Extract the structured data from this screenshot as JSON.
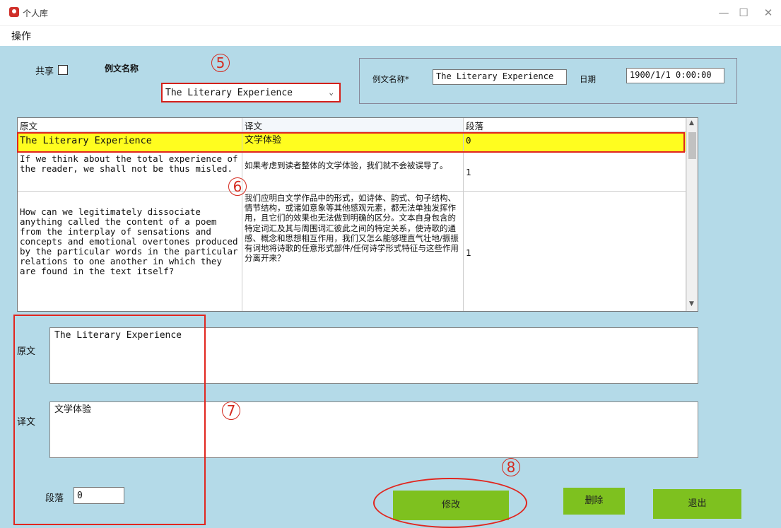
{
  "window": {
    "title": "个人库",
    "minimize_icon": "minimize-icon",
    "maximize_icon": "maximize-icon",
    "close_icon": "close-icon"
  },
  "menu": {
    "operate": "操作"
  },
  "share": {
    "label": "共享",
    "checked": false
  },
  "example_name_label": "例文名称",
  "example_combo": {
    "value": "The Literary Experience"
  },
  "info": {
    "name_label": "例文名称*",
    "name_value": "The Literary Experience",
    "date_label": "日期",
    "date_value": "1900/1/1 0:00:00"
  },
  "grid": {
    "headers": [
      "原文",
      "译文",
      "段落"
    ],
    "rows": [
      {
        "source": "The Literary Experience",
        "translation": "文学体验",
        "paragraph": "0"
      },
      {
        "source": "If we think about the total experience of the reader, we shall not be thus misled.",
        "translation": "如果考虑到读者整体的文学体验，我们就不会被误导了。",
        "paragraph": "1"
      },
      {
        "source": "How can we legitimately dissociate anything called the content of a poem from the interplay of sensations and concepts and emotional overtones produced by the particular words in the particular relations to one another in which they are found in the text itself?",
        "translation": "我们应明白文学作品中的形式，如诗体、韵式、句子结构、情节结构，或诸如意象等其他感观元素，都无法单独发挥作用，且它们的效果也无法做到明确的区分。文本自身包含的特定词汇及其与周围词汇彼此之间的特定关系，使诗歌的通感、概念和思想相互作用，我们又怎么能够理直气壮地/振振有词地将诗歌的任意形式部件/任何诗学形式特征与这些作用分离开来？",
        "paragraph": "1"
      }
    ]
  },
  "editor": {
    "source_label": "原文",
    "source_value": "The Literary Experience",
    "translation_label": "译文",
    "translation_value": "文学体验",
    "paragraph_label": "段落",
    "paragraph_value": "0"
  },
  "buttons": {
    "modify": "修改",
    "delete": "删除",
    "exit": "退出"
  },
  "annotations": {
    "n5": "5",
    "n6": "6",
    "n7": "7",
    "n8": "8"
  },
  "colors": {
    "background": "#b4dae8",
    "highlight_row": "#fffd1f",
    "button_green": "#7ec11f",
    "annotation_red": "#e1261f"
  }
}
